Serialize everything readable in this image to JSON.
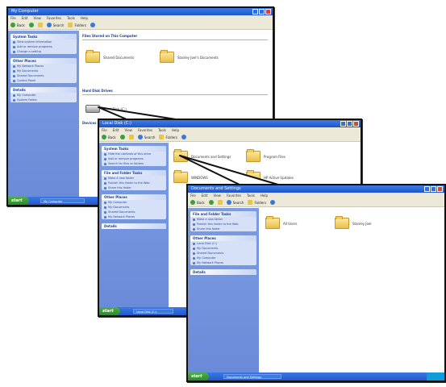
{
  "win1": {
    "title": "My Computer",
    "menu": [
      "File",
      "Edit",
      "View",
      "Favorites",
      "Tools",
      "Help"
    ],
    "toolbar": {
      "back": "Back",
      "search": "Search",
      "folders": "Folders"
    },
    "panels": [
      {
        "title": "System Tasks",
        "items": [
          "View system information",
          "Add or remove programs",
          "Change a setting"
        ]
      },
      {
        "title": "Other Places",
        "items": [
          "My Network Places",
          "My Documents",
          "Shared Documents",
          "Control Panel"
        ]
      },
      {
        "title": "Details",
        "items": [
          "My Computer",
          "System Folder"
        ]
      }
    ],
    "section_files": "Files Stored on This Computer",
    "section_drives": "Hard Disk Drives",
    "section_removable": "Devices with Removable Storage",
    "folders": [
      "Shared Documents",
      "Stanley Joel's Documents"
    ],
    "drive": "Local Disk (C:)",
    "taskbar": {
      "start": "start",
      "item": "My Computer"
    }
  },
  "win2": {
    "title": "Local Disk (C:)",
    "menu": [
      "File",
      "Edit",
      "View",
      "Favorites",
      "Tools",
      "Help"
    ],
    "toolbar": {
      "back": "Back",
      "search": "Search",
      "folders": "Folders"
    },
    "panels": [
      {
        "title": "System Tasks",
        "items": [
          "Hide the contents of this drive",
          "Add or remove programs",
          "Search for files or folders"
        ]
      },
      {
        "title": "File and Folder Tasks",
        "items": [
          "Make a new folder",
          "Publish this folder to the Web",
          "Share this folder"
        ]
      },
      {
        "title": "Other Places",
        "items": [
          "My Computer",
          "My Documents",
          "Shared Documents",
          "My Network Places"
        ]
      },
      {
        "title": "Details",
        "items": []
      }
    ],
    "folders": [
      "Documents and Settings",
      "Program Files",
      "WINDOWS",
      "HP Active Updates"
    ],
    "taskbar": {
      "start": "start",
      "item": "Local Disk (C:)"
    }
  },
  "win3": {
    "title": "Documents and Settings",
    "menu": [
      "File",
      "Edit",
      "View",
      "Favorites",
      "Tools",
      "Help"
    ],
    "toolbar": {
      "back": "Back",
      "search": "Search",
      "folders": "Folders"
    },
    "panels": [
      {
        "title": "File and Folder Tasks",
        "items": [
          "Make a new folder",
          "Publish this folder to the Web",
          "Share this folder"
        ]
      },
      {
        "title": "Other Places",
        "items": [
          "Local Disk (C:)",
          "My Documents",
          "Shared Documents",
          "My Computer",
          "My Network Places"
        ]
      },
      {
        "title": "Details",
        "items": []
      }
    ],
    "folders": [
      "All Users",
      "Stanley Joel"
    ],
    "taskbar": {
      "start": "start",
      "item": "Documents and Settings",
      "clock": ""
    }
  },
  "colors": {
    "xp_blue": "#2458c8",
    "start_green": "#3a9a36",
    "sidebar": "#7b9de4",
    "folder": "#f1cd62"
  }
}
